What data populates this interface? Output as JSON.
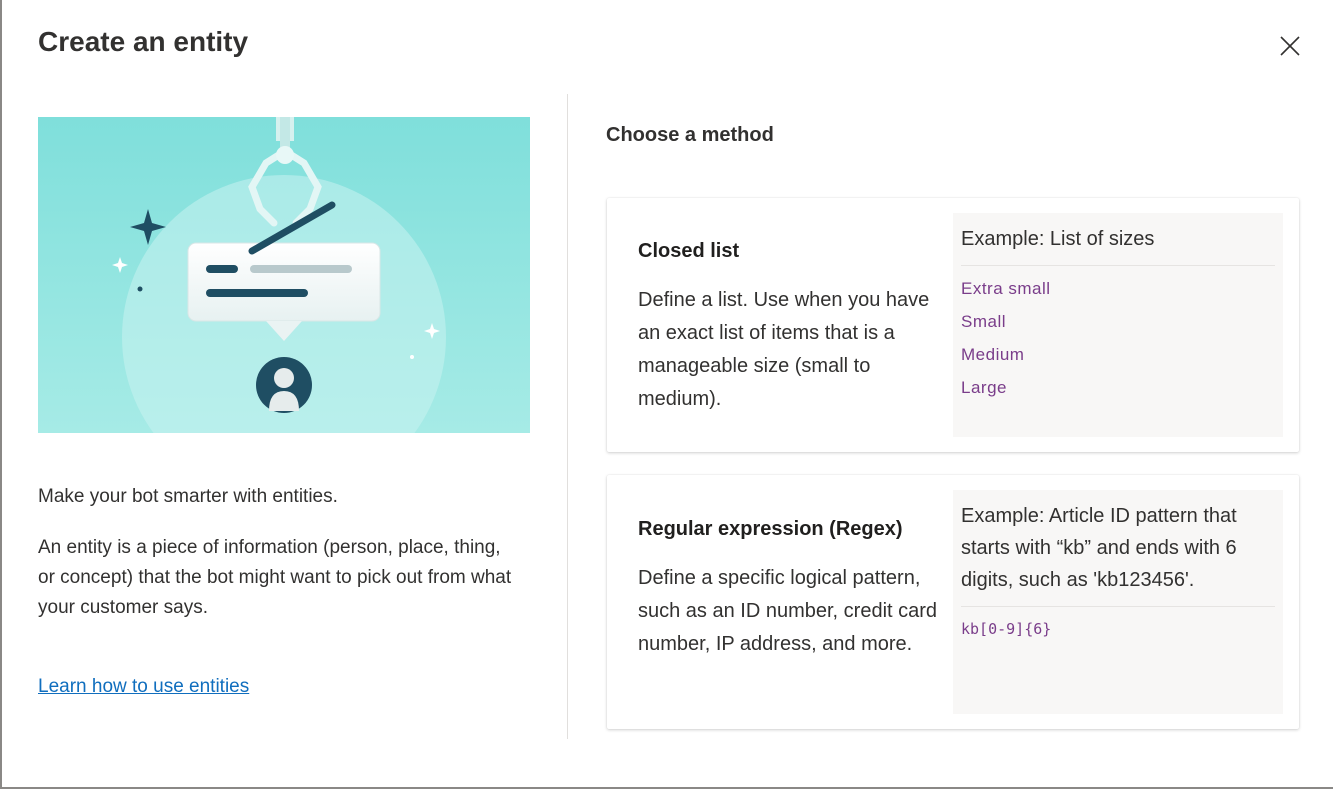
{
  "dialog": {
    "title": "Create an entity",
    "close_label": "Close"
  },
  "left": {
    "intro": "Make your bot smarter with entities.",
    "description": "An entity is a piece of information (person, place, thing, or concept) that the bot might want to pick out from what your customer says.",
    "learn_link": "Learn how to use entities"
  },
  "main": {
    "section_title": "Choose a method",
    "cards": [
      {
        "title": "Closed list",
        "description": "Define a list. Use when you have an exact list of items that is a manageable size (small to medium).",
        "example_title": "Example: List of sizes",
        "example_items": [
          "Extra small",
          "Small",
          "Medium",
          "Large"
        ]
      },
      {
        "title": "Regular expression (Regex)",
        "description": "Define a specific logical pattern, such as an ID number, credit card number, IP address, and more.",
        "example_title": "Example: Article ID pattern that starts with “kb” and ends with 6 digits, such as 'kb123456'.",
        "example_items": [
          "kb[0-9]{6}"
        ]
      }
    ]
  },
  "colors": {
    "highlight": "#ffe800",
    "link": "#106ebe",
    "example_text": "#7a3d8a",
    "illustration_bg": "#7fdfdb"
  },
  "icons": [
    "close-icon",
    "claw-icon",
    "sparkle-icon",
    "chat-bubble-icon",
    "person-icon"
  ]
}
